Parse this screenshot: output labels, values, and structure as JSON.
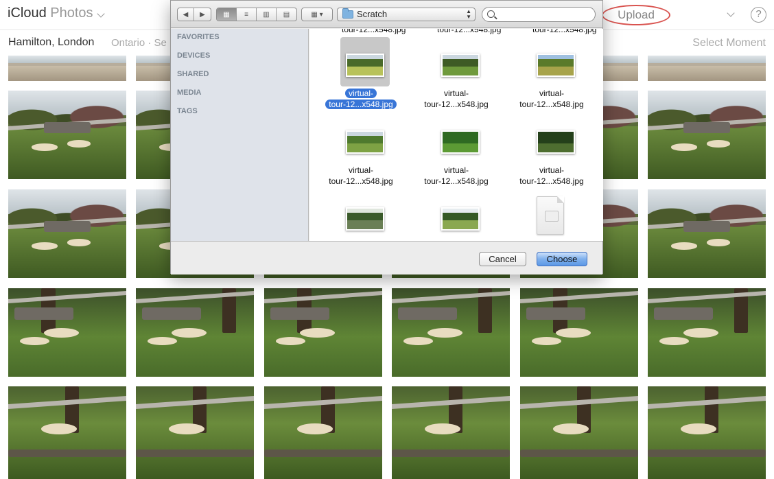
{
  "header": {
    "brand_icloud": "iCloud",
    "brand_photos": "Photos",
    "upload_label": "Upload",
    "help_label": "?"
  },
  "subheader": {
    "location": "Hamilton, London",
    "sublocation": "Ontario · Se",
    "select_moment": "Select Moment"
  },
  "dialog": {
    "location": "Scratch",
    "search_placeholder": "",
    "sidebar": [
      "FAVORITES",
      "DEVICES",
      "SHARED",
      "MEDIA",
      "TAGS"
    ],
    "top_cut_labels": [
      "tour-12...x548.jpg",
      "tour-12...x548.jpg",
      "tour-12...x548.jpg"
    ],
    "files": [
      {
        "line1": "virtual-",
        "line2": "tour-12...x548.jpg",
        "selected": true
      },
      {
        "line1": "virtual-",
        "line2": "tour-12...x548.jpg",
        "selected": false
      },
      {
        "line1": "virtual-",
        "line2": "tour-12...x548.jpg",
        "selected": false
      },
      {
        "line1": "virtual-",
        "line2": "tour-12...x548.jpg",
        "selected": false
      },
      {
        "line1": "virtual-",
        "line2": "tour-12...x548.jpg",
        "selected": false
      },
      {
        "line1": "virtual-",
        "line2": "tour-12...x548.jpg",
        "selected": false
      }
    ],
    "cancel_label": "Cancel",
    "choose_label": "Choose"
  },
  "colors": {
    "upload_highlight": "#d9534f",
    "selection": "#3875d7",
    "sidebar_bg": "#dfe3ea",
    "header_text": "#333333",
    "muted_text": "#aaaaaa"
  }
}
